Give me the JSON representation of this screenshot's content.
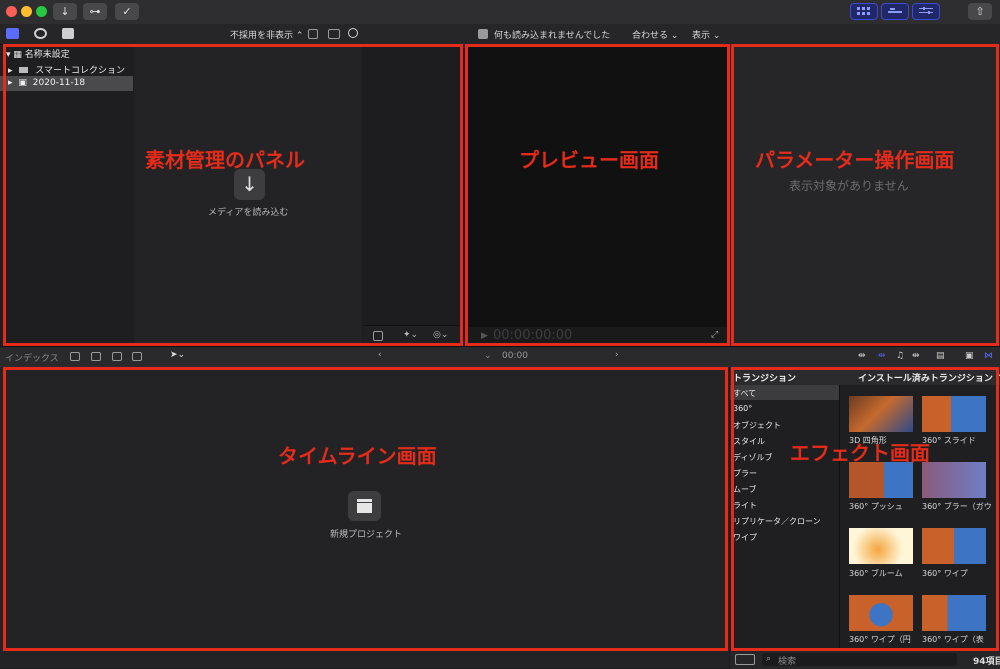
{
  "toolbar": {
    "library_import_glyph": "↓",
    "key_glyph": "⊶",
    "check_glyph": "✓",
    "share_glyph": "⇧"
  },
  "browser_bar": {
    "hide_rejected": "不採用を非表示 ⌃"
  },
  "viewer_bar": {
    "status": "何も読み込まれませんでした",
    "fit": "合わせる ⌄",
    "view": "表示 ⌄"
  },
  "sidebar": {
    "items": [
      {
        "label": "名称未設定"
      },
      {
        "label": "スマートコレクション"
      },
      {
        "label": "2020-11-18"
      }
    ]
  },
  "browser": {
    "import_label": "メディアを読み込む",
    "import_glyph": "↓"
  },
  "viewer": {
    "timecode": "00:00:00:00"
  },
  "inspector": {
    "empty": "表示対象がありません"
  },
  "timeline_bar": {
    "index": "インデックス",
    "timecode": "00:00"
  },
  "timeline": {
    "new_project": "新規プロジェクト"
  },
  "effects": {
    "category_header": "トランジション",
    "installed": "インストール済みトランジション ⌃",
    "categories": [
      {
        "label": "すべて"
      },
      {
        "label": "360°"
      },
      {
        "label": "オブジェクト"
      },
      {
        "label": "スタイル"
      },
      {
        "label": "ディゾルブ"
      },
      {
        "label": "ブラー"
      },
      {
        "label": "ムーブ"
      },
      {
        "label": "ライト"
      },
      {
        "label": "リプリケータ／クローン"
      },
      {
        "label": "ワイプ"
      }
    ],
    "items": [
      {
        "label": "3D 四角形"
      },
      {
        "label": "360° スライド"
      },
      {
        "label": "360° プッシュ"
      },
      {
        "label": "360° ブラー（ガウ"
      },
      {
        "label": "360° ブルーム"
      },
      {
        "label": "360° ワイプ"
      },
      {
        "label": "360° ワイプ（円"
      },
      {
        "label": "360° ワイプ（表"
      }
    ],
    "search_placeholder": "検索",
    "count": "94項目"
  },
  "annotations": {
    "browser_panel": "素材管理のパネル",
    "preview": "プレビュー画面",
    "parameters": "パラメーター操作画面",
    "timeline": "タイムライン画面",
    "effects": "エフェクト画面"
  },
  "colors": {
    "annotation_red": "#e52b1a",
    "accent_blue": "#3b4bd1"
  }
}
